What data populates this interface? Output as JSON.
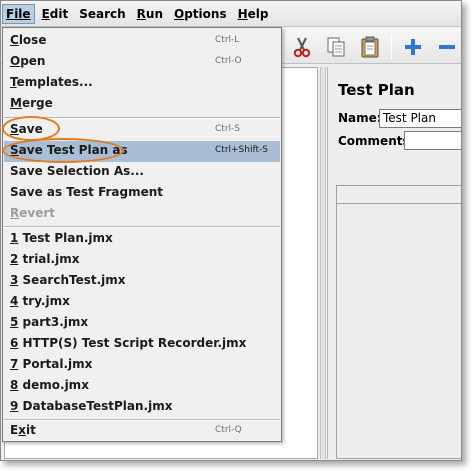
{
  "menubar": {
    "items": [
      {
        "label": "File",
        "mnemonic": "F"
      },
      {
        "label": "Edit",
        "mnemonic": "E"
      },
      {
        "label": "Search",
        "mnemonic": "S"
      },
      {
        "label": "Run",
        "mnemonic": "R"
      },
      {
        "label": "Options",
        "mnemonic": "O"
      },
      {
        "label": "Help",
        "mnemonic": "H"
      }
    ]
  },
  "toolbar": {
    "buttons": [
      {
        "icon": "cut-icon"
      },
      {
        "icon": "copy-icon"
      },
      {
        "icon": "paste-icon"
      },
      {
        "icon": "expand-icon"
      },
      {
        "icon": "collapse-icon"
      }
    ]
  },
  "file_menu": {
    "close": {
      "label": "Close",
      "mnemonic": "C",
      "rest": "lose",
      "accel": "Ctrl-L"
    },
    "open": {
      "label": "Open",
      "mnemonic": "O",
      "rest": "pen",
      "accel": "Ctrl-O"
    },
    "templates": {
      "label": "Templates...",
      "mnemonic": "T",
      "rest": "emplates..."
    },
    "merge": {
      "label": "Merge",
      "mnemonic": "M",
      "rest": "erge"
    },
    "save": {
      "label": "Save",
      "mnemonic": "S",
      "rest": "ave",
      "accel": "Ctrl-S"
    },
    "save_as": {
      "label": "Save Test Plan as",
      "mnemonic": "S",
      "rest": "ave Test Plan as",
      "accel": "Ctrl+Shift-S"
    },
    "save_selection": {
      "label": "Save Selection As..."
    },
    "save_fragment": {
      "label": "Save as Test Fragment"
    },
    "revert": {
      "label": "Revert",
      "mnemonic": "R",
      "rest": "evert",
      "disabled": true
    },
    "recent": [
      {
        "num": "1",
        "name": " Test Plan.jmx"
      },
      {
        "num": "2",
        "name": " trial.jmx"
      },
      {
        "num": "3",
        "name": " SearchTest.jmx"
      },
      {
        "num": "4",
        "name": " try.jmx"
      },
      {
        "num": "5",
        "name": " part3.jmx"
      },
      {
        "num": "6",
        "name": " HTTP(S) Test Script Recorder.jmx"
      },
      {
        "num": "7",
        "name": " Portal.jmx"
      },
      {
        "num": "8",
        "name": " demo.jmx"
      },
      {
        "num": "9",
        "name": " DatabaseTestPlan.jmx"
      }
    ],
    "exit": {
      "label": "Exit",
      "mnemonic": "x",
      "pre": "E",
      "rest": "it",
      "accel": "Ctrl-Q"
    }
  },
  "right_panel": {
    "title": "Test Plan",
    "name_label": "Name:",
    "name_value": "Test Plan",
    "comments_label": "Comments:"
  },
  "colors": {
    "highlight": "#e07b1f",
    "selection": "#a9bed5"
  }
}
